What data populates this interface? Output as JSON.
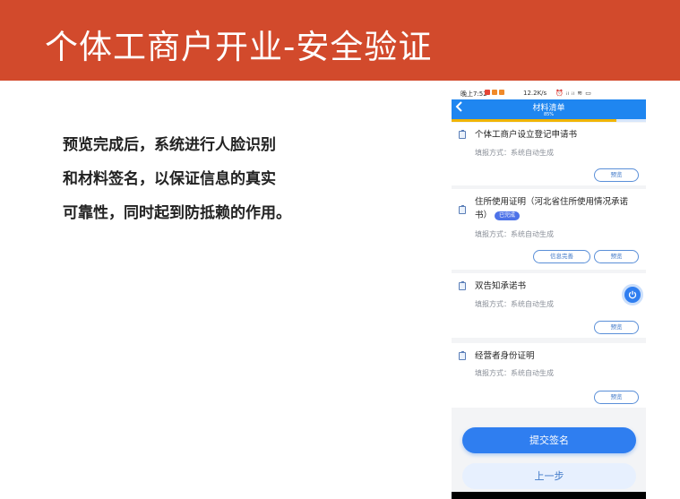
{
  "slide": {
    "title": "个体工商户开业-安全验证",
    "description_lines": [
      "预览完成后，系统进行人脸识别",
      "和材料签名，以保证信息的真实",
      "可靠性，同时起到防抵赖的作用。"
    ]
  },
  "phone": {
    "status_bar": {
      "time": "晚上7:52",
      "speed": "12.2K/s",
      "signal": "⏰ ᵢₗ ᵢₗ ≋ ▭"
    },
    "nav": {
      "back_icon": "chevron-left-icon",
      "title": "材料清单"
    },
    "progress": {
      "percent": 85,
      "label": "85%"
    },
    "materials": [
      {
        "title": "个体工商户设立登记申请书",
        "fill_method": "填报方式：系统自动生成",
        "badge": "",
        "buttons": [
          "预览"
        ]
      },
      {
        "title": "住所使用证明（河北省住所使用情况承诺书）",
        "fill_method": "填报方式：系统自动生成",
        "badge": "已完成",
        "buttons": [
          "信息完善",
          "预览"
        ]
      },
      {
        "title": "双告知承诺书",
        "fill_method": "填报方式：系统自动生成",
        "badge": "",
        "buttons": [
          "预览"
        ]
      },
      {
        "title": "经营者身份证明",
        "fill_method": "填报方式：系统自动生成",
        "badge": "",
        "buttons": [
          "预览"
        ]
      }
    ],
    "floating_button_icon": "power-icon",
    "submit_label": "提交签名",
    "prev_label": "上一步"
  },
  "colors": {
    "header": "#d24a2c",
    "primary": "#2f7ef0",
    "progress": "#f0b400"
  }
}
